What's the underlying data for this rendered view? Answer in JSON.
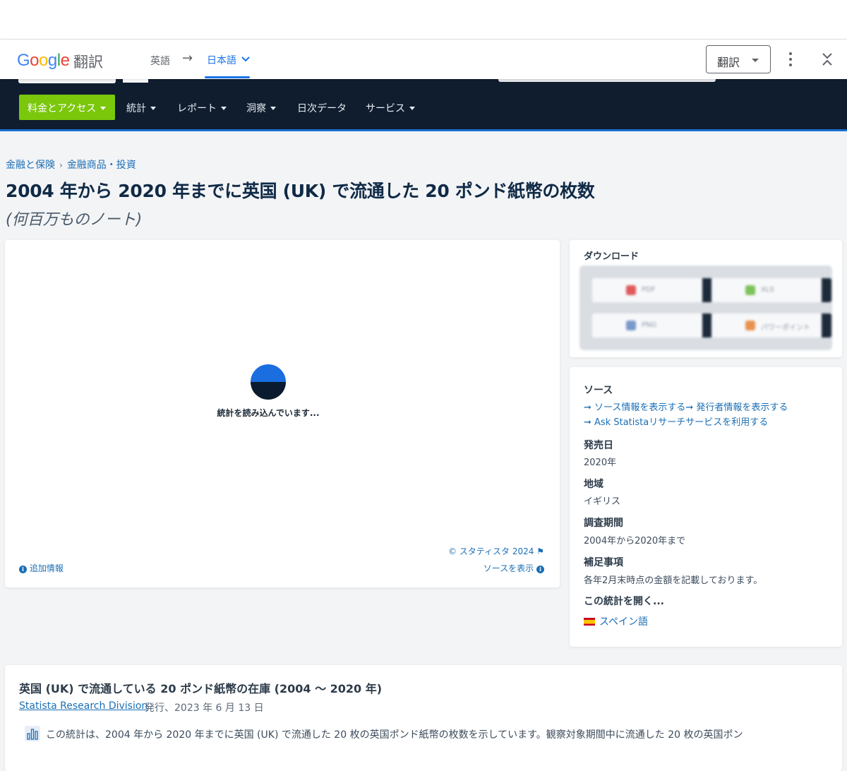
{
  "translate_bar": {
    "logo": "Google",
    "title": "翻訳",
    "source_lang": "英語",
    "arrow": "→",
    "target_lang": "日本語",
    "translate_button": "翻訳"
  },
  "nav": {
    "pricing": "料金とアクセス",
    "items": [
      "統計",
      "レポート",
      "洞察",
      "日次データ",
      "サービス"
    ]
  },
  "breadcrumb": [
    "金融と保険",
    "金融商品・投資"
  ],
  "page": {
    "title": "2004 年から 2020 年までに英国 (UK) で流通した 20 ポンド紙幣の枚数",
    "subtitle": "(何百万ものノート)"
  },
  "chart_card": {
    "loading": "統計を読み込んでいます...",
    "copyright": "© スタティスタ 2024",
    "flag_icon": "⚑",
    "show_source": "ソースを表示",
    "additional_info": "追加情報"
  },
  "download": {
    "title": "ダウンロード",
    "buttons": [
      "PDF",
      "XLS",
      "PNG",
      "パワーポイント"
    ]
  },
  "source": {
    "heading": "ソース",
    "link1": "➞ ソース情報を表示する➞ 発行者情報を表示する",
    "link2": "➞ Ask Statistaリサーチサービスを利用する",
    "release_h": "発売日",
    "release_v": "2020年",
    "region_h": "地域",
    "region_v": "イギリス",
    "period_h": "調査期間",
    "period_v": "2004年から2020年まで",
    "notes_h": "補足事項",
    "notes_v": "各年2月末時点の金額を記載しております。",
    "open_h": "この統計を開く...",
    "open_lang": "スペイン語"
  },
  "description": {
    "title": "英国 (UK) で流通している 20 ポンド紙幣の在庫 (2004 ～ 2020 年)",
    "author": "Statista Research Division",
    "date": "発行、2023 年 6 月 13 日",
    "text": "この統計は、2004 年から 2020 年までに英国 (UK) で流通した 20 枚の英国ポンド紙幣の枚数を示しています。観察対象期間中に流通した 20 枚の英国ポン"
  }
}
